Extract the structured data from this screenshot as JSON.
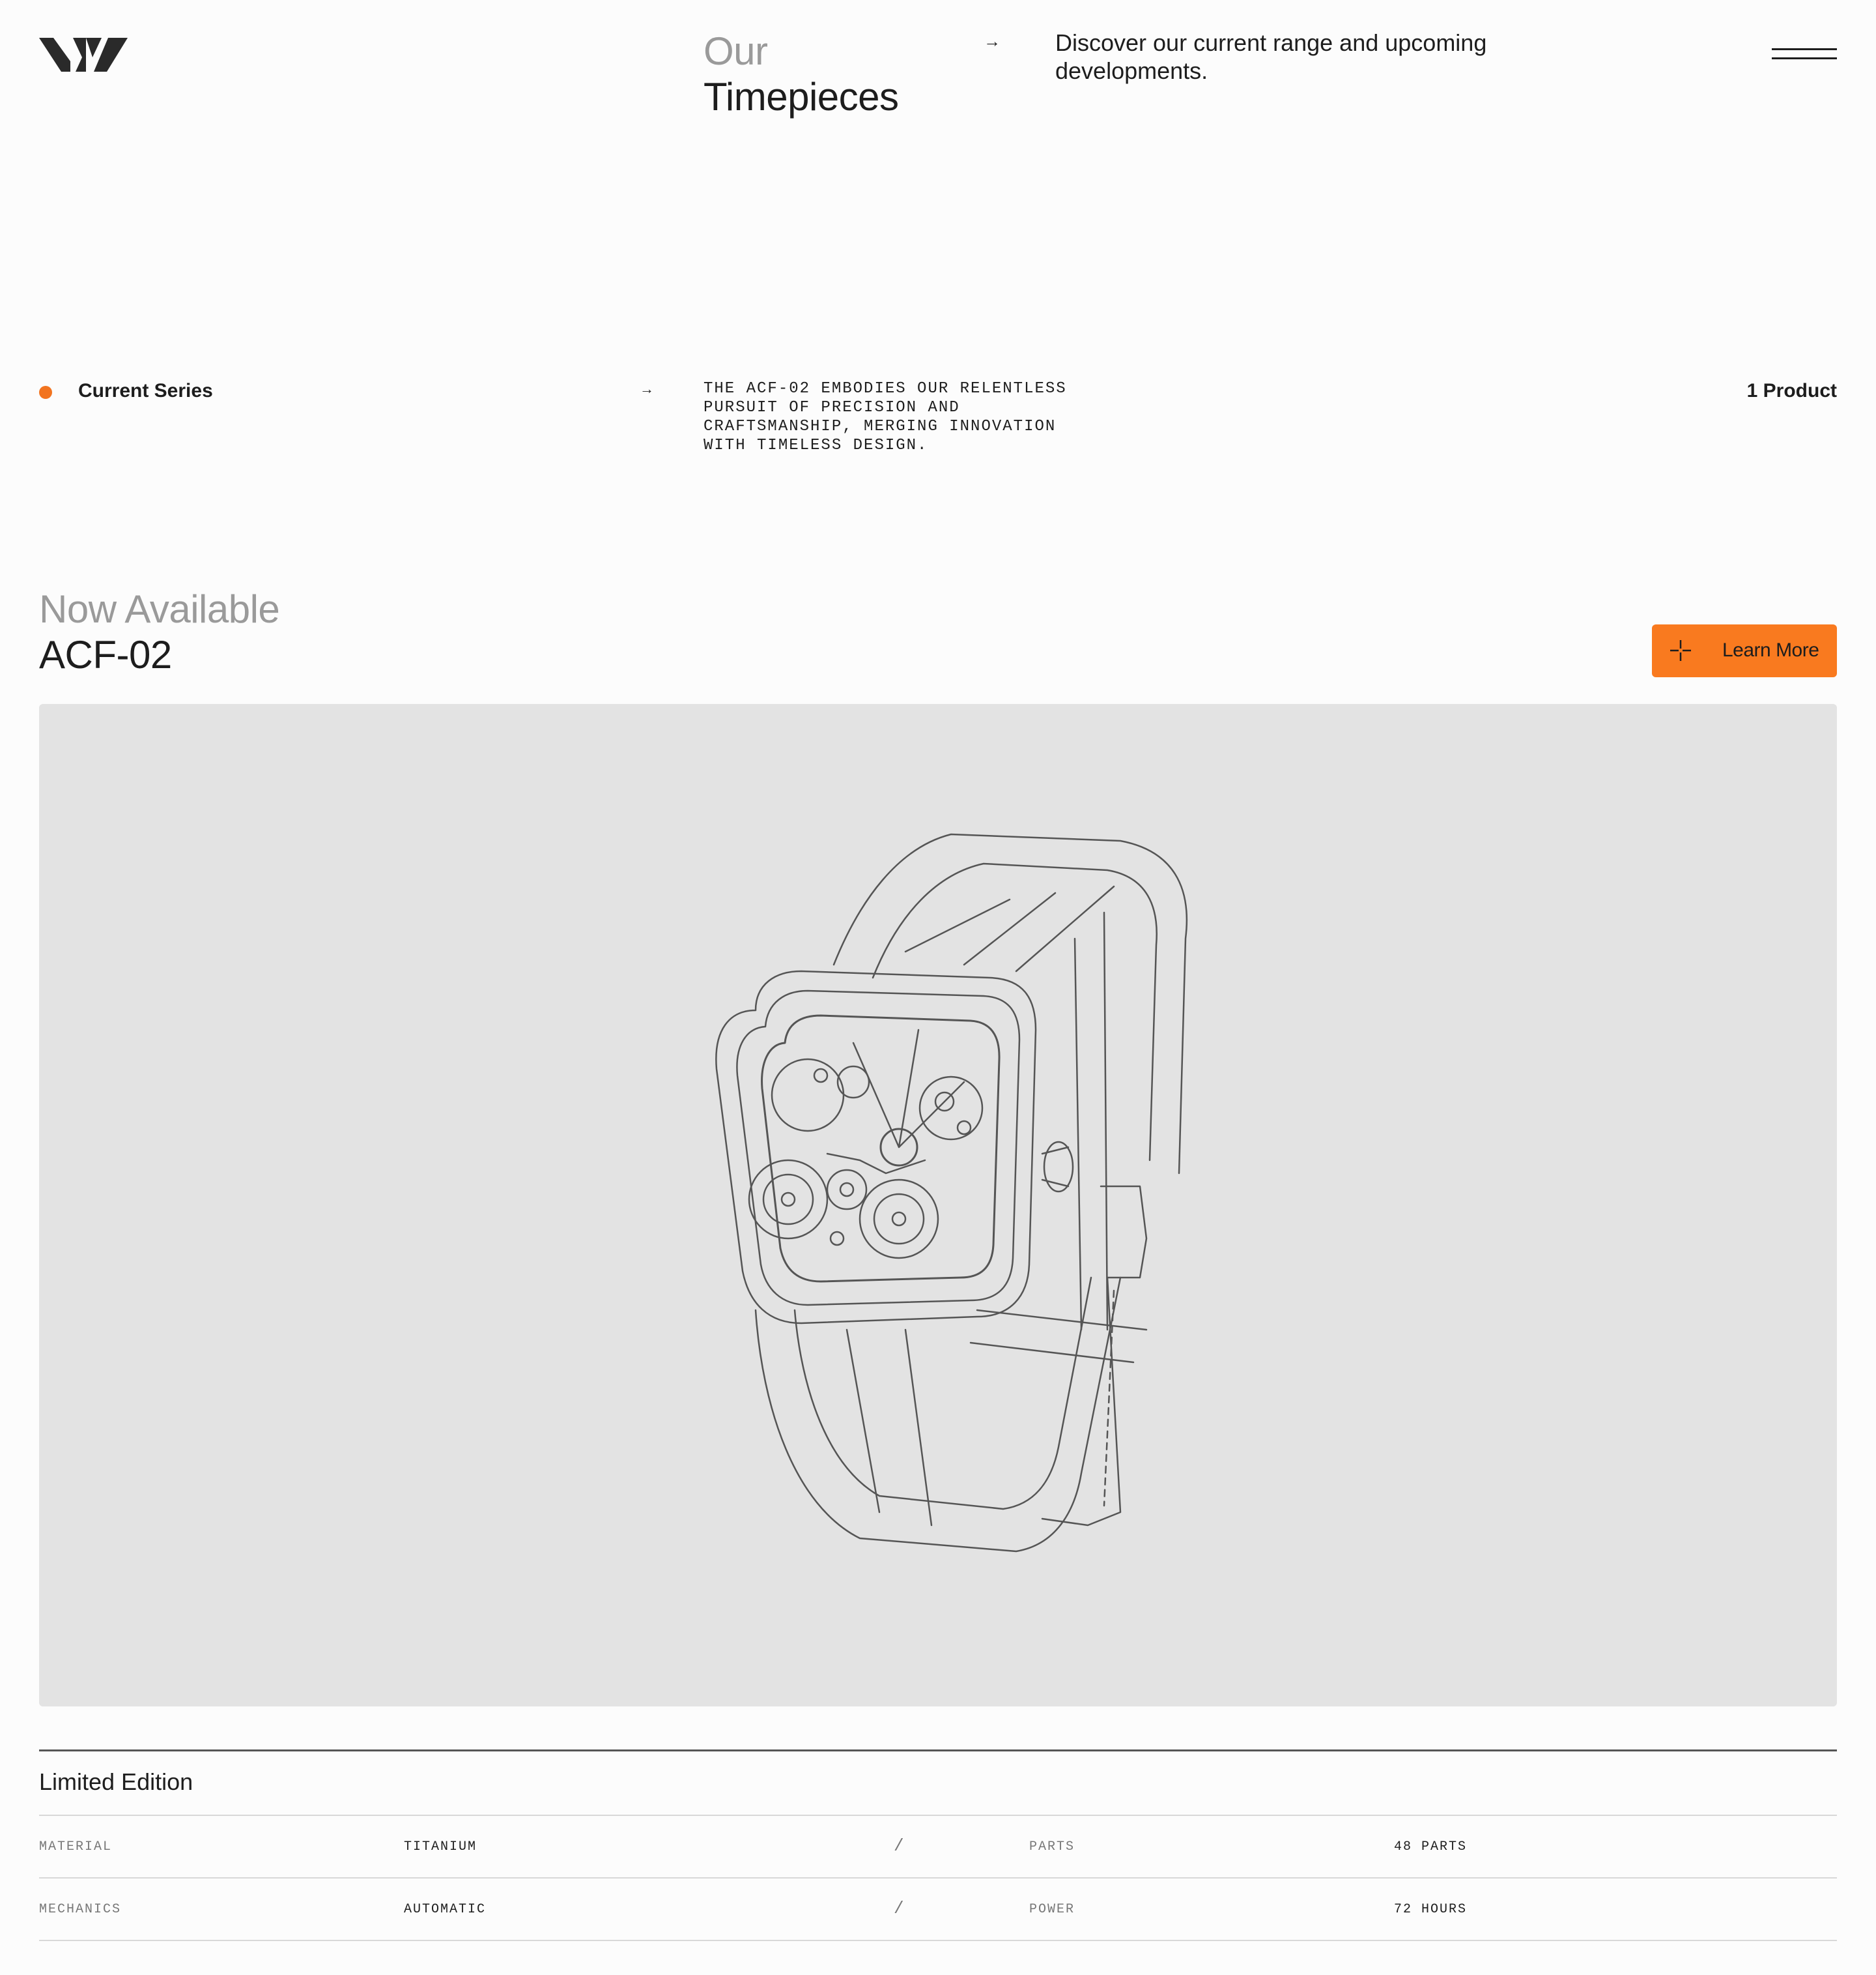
{
  "header": {
    "title_line1": "Our",
    "title_line2": "Timepieces",
    "arrow": "→",
    "description": "Discover our current range and upcoming developments."
  },
  "series": {
    "label": "Current Series",
    "arrow": "→",
    "description": "THE ACF-02 EMBODIES OUR RELENTLESS\nPURSUIT OF PRECISION AND\nCRAFTSMANSHIP, MERGING INNOVATION\nWITH TIMELESS DESIGN.",
    "count": "1 Product",
    "dot_color": "#f27420"
  },
  "product": {
    "kicker": "Now Available",
    "name": "ACF-02",
    "cta_label": "Learn More",
    "cta_color": "#f97a1f",
    "image_icon": "watch-wireframe"
  },
  "specs": {
    "title": "Limited Edition",
    "rows": [
      {
        "k1": "MATERIAL",
        "v1": "TITANIUM",
        "sep": "/",
        "k2": "PARTS",
        "v2": "48 PARTS"
      },
      {
        "k1": "MECHANICS",
        "v1": "AUTOMATIC",
        "sep": "/",
        "k2": "POWER",
        "v2": "72 HOURS"
      }
    ]
  }
}
